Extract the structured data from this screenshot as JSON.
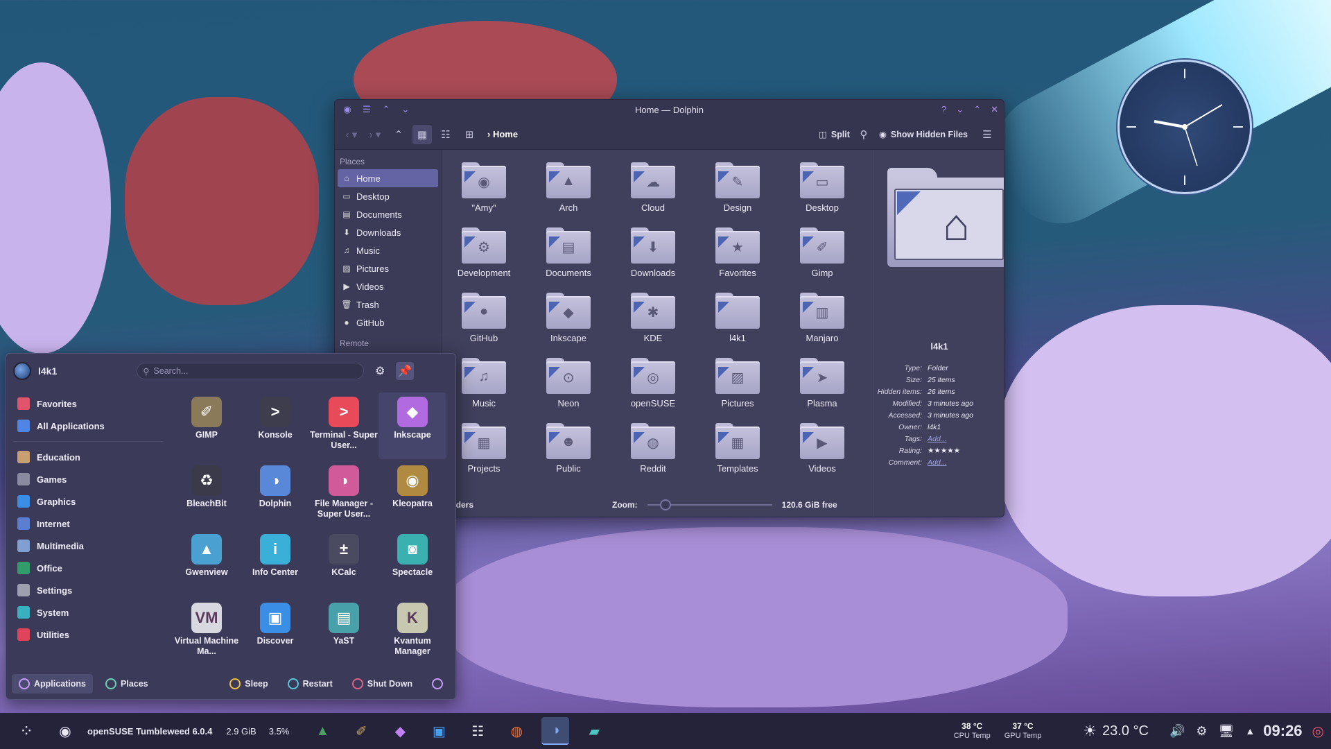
{
  "window": {
    "title": "Home — Dolphin",
    "breadcrumb": "Home",
    "split_label": "Split",
    "hidden_files_label": "Show Hidden Files"
  },
  "places": {
    "header": "Places",
    "items": [
      {
        "label": "Home",
        "icon": "home-icon"
      },
      {
        "label": "Desktop",
        "icon": "desktop-icon"
      },
      {
        "label": "Documents",
        "icon": "documents-icon"
      },
      {
        "label": "Downloads",
        "icon": "downloads-icon"
      },
      {
        "label": "Music",
        "icon": "music-icon"
      },
      {
        "label": "Pictures",
        "icon": "pictures-icon"
      },
      {
        "label": "Videos",
        "icon": "videos-icon"
      },
      {
        "label": "Trash",
        "icon": "trash-icon"
      },
      {
        "label": "GitHub",
        "icon": "github-icon"
      }
    ],
    "remote_header": "Remote"
  },
  "files": [
    {
      "name": "\"Amy\"",
      "glyph": "◉"
    },
    {
      "name": "Arch",
      "glyph": "▲"
    },
    {
      "name": "Cloud",
      "glyph": "☁"
    },
    {
      "name": "Design",
      "glyph": "✎"
    },
    {
      "name": "Desktop",
      "glyph": "▭"
    },
    {
      "name": "Development",
      "glyph": "⚙"
    },
    {
      "name": "Documents",
      "glyph": "▤"
    },
    {
      "name": "Downloads",
      "glyph": "⬇"
    },
    {
      "name": "Favorites",
      "glyph": "★"
    },
    {
      "name": "Gimp",
      "glyph": "✐"
    },
    {
      "name": "GitHub",
      "glyph": "●"
    },
    {
      "name": "Inkscape",
      "glyph": "◆"
    },
    {
      "name": "KDE",
      "glyph": "✱"
    },
    {
      "name": "l4k1",
      "glyph": ""
    },
    {
      "name": "Manjaro",
      "glyph": "▥"
    },
    {
      "name": "Music",
      "glyph": "♫"
    },
    {
      "name": "Neon",
      "glyph": "⊙"
    },
    {
      "name": "openSUSE",
      "glyph": "◎"
    },
    {
      "name": "Pictures",
      "glyph": "▨"
    },
    {
      "name": "Plasma",
      "glyph": "➤"
    },
    {
      "name": "Projects",
      "glyph": "▦"
    },
    {
      "name": "Public",
      "glyph": "☻"
    },
    {
      "name": "Reddit",
      "glyph": "◍"
    },
    {
      "name": "Templates",
      "glyph": "▦"
    },
    {
      "name": "Videos",
      "glyph": "▶"
    }
  ],
  "preview": {
    "name": "l4k1",
    "meta": [
      {
        "k": "Type:",
        "v": "Folder",
        "link": false
      },
      {
        "k": "Size:",
        "v": "25 items",
        "link": false
      },
      {
        "k": "Hidden items:",
        "v": "26 items",
        "link": false
      },
      {
        "k": "Modified:",
        "v": "3 minutes ago",
        "link": false
      },
      {
        "k": "Accessed:",
        "v": "3 minutes ago",
        "link": false
      },
      {
        "k": "Owner:",
        "v": "l4k1",
        "link": false
      },
      {
        "k": "Tags:",
        "v": "Add...",
        "link": true
      },
      {
        "k": "Rating:",
        "v": "★★★★★",
        "link": false
      },
      {
        "k": "Comment:",
        "v": "Add...",
        "link": true
      }
    ]
  },
  "status": {
    "left": "folders",
    "zoom_label": "Zoom:",
    "zoom_level": 0.1,
    "free": "120.6 GiB free"
  },
  "launcher": {
    "user": "l4k1",
    "search_placeholder": "Search...",
    "categories": [
      {
        "label": "Favorites",
        "color": "#e0556b"
      },
      {
        "label": "All Applications",
        "color": "#4f86e6"
      }
    ],
    "groups": [
      {
        "label": "Education",
        "color": "#c8a070"
      },
      {
        "label": "Games",
        "color": "#8a8aa0"
      },
      {
        "label": "Graphics",
        "color": "#3a8ee6"
      },
      {
        "label": "Internet",
        "color": "#5a7ed0"
      },
      {
        "label": "Multimedia",
        "color": "#7fa0d0"
      },
      {
        "label": "Office",
        "color": "#2f9e6a"
      },
      {
        "label": "Settings",
        "color": "#9ea0b0"
      },
      {
        "label": "System",
        "color": "#38b0c0"
      },
      {
        "label": "Utilities",
        "color": "#e0445a"
      }
    ],
    "apps": [
      {
        "label": "GIMP",
        "color": "#8a7a5a",
        "glyph": "✐"
      },
      {
        "label": "Konsole",
        "color": "#3d3d4d",
        "glyph": ">"
      },
      {
        "label": "Terminal - Super User...",
        "color": "#e84a5a",
        "glyph": ">"
      },
      {
        "label": "Inkscape",
        "color": "#b26ae0",
        "glyph": "◆"
      },
      {
        "label": "BleachBit",
        "color": "#3a3a4a",
        "glyph": "♻"
      },
      {
        "label": "Dolphin",
        "color": "#5a88d8",
        "glyph": "◑"
      },
      {
        "label": "File Manager - Super User...",
        "color": "#d05a9a",
        "glyph": "◑"
      },
      {
        "label": "Kleopatra",
        "color": "#b08a40",
        "glyph": "◉"
      },
      {
        "label": "Gwenview",
        "color": "#4aa0d0",
        "glyph": "▲"
      },
      {
        "label": "Info Center",
        "color": "#3ab0d8",
        "glyph": "i"
      },
      {
        "label": "KCalc",
        "color": "#4a4a60",
        "glyph": "±"
      },
      {
        "label": "Spectacle",
        "color": "#3ab0b0",
        "glyph": "◙"
      },
      {
        "label": "Virtual Machine Ma...",
        "color": "#d8d8e0",
        "glyph": "VM"
      },
      {
        "label": "Discover",
        "color": "#3a8ee6",
        "glyph": "▣"
      },
      {
        "label": "YaST",
        "color": "#48a0a8",
        "glyph": "▤"
      },
      {
        "label": "Kvantum Manager",
        "color": "#c8c8b0",
        "glyph": "K"
      }
    ],
    "footer": {
      "applications": "Applications",
      "places": "Places",
      "sleep": "Sleep",
      "restart": "Restart",
      "shutdown": "Shut Down"
    }
  },
  "taskbar": {
    "os": "openSUSE Tumbleweed 6.0.4",
    "mem": "2.9 GiB",
    "cpu": "3.5%",
    "cpu_temp": "38 °C",
    "cpu_temp_label": "CPU Temp",
    "gpu_temp": "37 °C",
    "gpu_temp_label": "GPU Temp",
    "weather": "23.0 °C",
    "time": "09:26"
  }
}
